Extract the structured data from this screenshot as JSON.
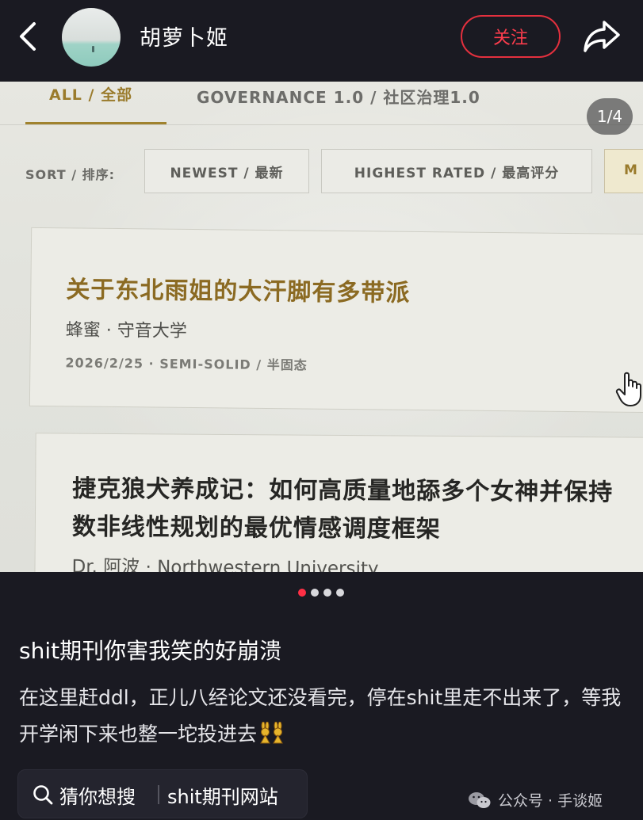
{
  "header": {
    "username": "胡萝卜姬",
    "follow_label": "关注"
  },
  "photo": {
    "pager": "1/4",
    "tabs": [
      {
        "label": "ALL / 全部",
        "active": true
      },
      {
        "label": "GOVERNANCE 1.0 / 社区治理1.0",
        "active": false
      }
    ],
    "sort": {
      "label": "SORT / 排序:",
      "options": [
        "NEWEST / 最新",
        "HIGHEST RATED / 最高评分",
        "M"
      ]
    },
    "papers": [
      {
        "title": "关于东北雨姐的大汗脚有多带派",
        "author": "蜂蜜 · 守音大学",
        "meta": "2026/2/25  ·  SEMI-SOLID / 半固态"
      },
      {
        "title_line1": "捷克狼犬养成记：如何高质量地舔多个女神并保持",
        "title_line2": "数非线性规划的最优情感调度框架",
        "author": "Dr. 阿波 · Northwestern University"
      }
    ]
  },
  "carousel": {
    "count": 4,
    "active": 0
  },
  "post": {
    "title": "shit期刊你害我笑的好崩溃",
    "body": "在这里赶ddl，正儿八经论文还没看完，停在shit里走不出来了，等我开学闲下来也整一坨投进去"
  },
  "search_chip": {
    "guess_label": "猜你想搜",
    "query": "shit期刊网站"
  },
  "watermark": "公众号 · 手谈姬",
  "colors": {
    "background": "#1a1a22",
    "accent_red": "#e4303e",
    "gold": "#9a7b2c"
  }
}
